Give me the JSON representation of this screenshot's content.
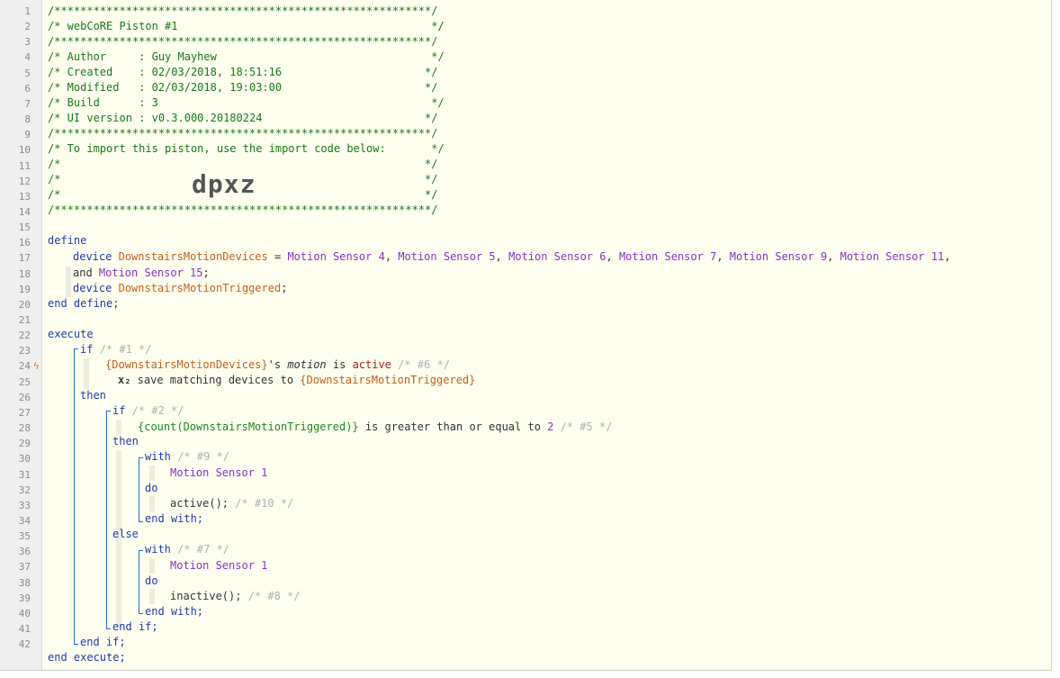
{
  "header": {
    "stars": "/**********************************************************/",
    "title": "/* webCoRE Piston #1                                       */",
    "author": "/* Author     : Guy Mayhew                                 */",
    "created": "/* Created    : 02/03/2018, 18:51:16                      */",
    "modified": "/* Modified   : 02/03/2018, 19:03:00                      */",
    "build": "/* Build      : 3                                          */",
    "ui_version": "/* UI version : v0.3.000.20180224                         */",
    "import_note": "/* To import this piston, use the import code below:       */",
    "blank": "/*                                                        */",
    "import_code": "dpxz"
  },
  "define": {
    "kw": "define",
    "device_kw": "device",
    "var1": "DownstairsMotionDevices",
    "eq": " = ",
    "sensors": [
      "Motion Sensor 4",
      "Motion Sensor 5",
      "Motion Sensor 6",
      "Motion Sensor 7",
      "Motion Sensor 9",
      "Motion Sensor 11"
    ],
    "and": "and ",
    "last_sensor": "Motion Sensor 15",
    "var2": "DownstairsMotionTriggered",
    "end": "end define;"
  },
  "execute": {
    "kw": "execute",
    "if1": "if",
    "if1_cm": "/* #1 */",
    "cond1_var": "{DownstairsMotionDevices}",
    "cond1_mid": "'s ",
    "cond1_attr": "motion",
    "cond1_is": " is ",
    "cond1_val": "active",
    "cond1_cm": "/* #6 */",
    "save_icon": "x₂",
    "save_text": " save matching devices to ",
    "save_var": "{DownstairsMotionTriggered}",
    "then": "then",
    "if2": "if",
    "if2_cm": "/* #2 */",
    "cond2_expr": "{count(DownstairsMotionTriggered)}",
    "cond2_text": " is greater than or equal to ",
    "cond2_num": "2",
    "cond2_cm": "/* #5 */",
    "then2": "then",
    "with1": "with",
    "with1_cm": "/* #9 */",
    "with_dev": "Motion Sensor 1",
    "do": "do",
    "act1": "active();",
    "act1_cm": "/* #10 */",
    "endwith": "end with;",
    "else": "else",
    "with2": "with",
    "with2_cm": "/* #7 */",
    "act2": "inactive();",
    "act2_cm": "/* #8 */",
    "endif": "end if;",
    "end": "end execute;"
  },
  "line_numbers": [
    "1",
    "2",
    "3",
    "4",
    "5",
    "6",
    "7",
    "8",
    "9",
    "10",
    "11",
    "12",
    "13",
    "14",
    "15",
    "16",
    "17",
    "18",
    "19",
    "20",
    "21",
    "22",
    "23",
    "24",
    "25",
    "26",
    "27",
    "28",
    "29",
    "30",
    "31",
    "32",
    "33",
    "34",
    "35",
    "36",
    "37",
    "38",
    "39",
    "40",
    "41",
    "42"
  ],
  "colors": {
    "comment": "#137a13",
    "keyword": "#1f3aa6",
    "variable": "#c25e1a",
    "device": "#8432c4",
    "trigger_bolt": "#e8761e",
    "nesting": "#1a6fd0"
  }
}
